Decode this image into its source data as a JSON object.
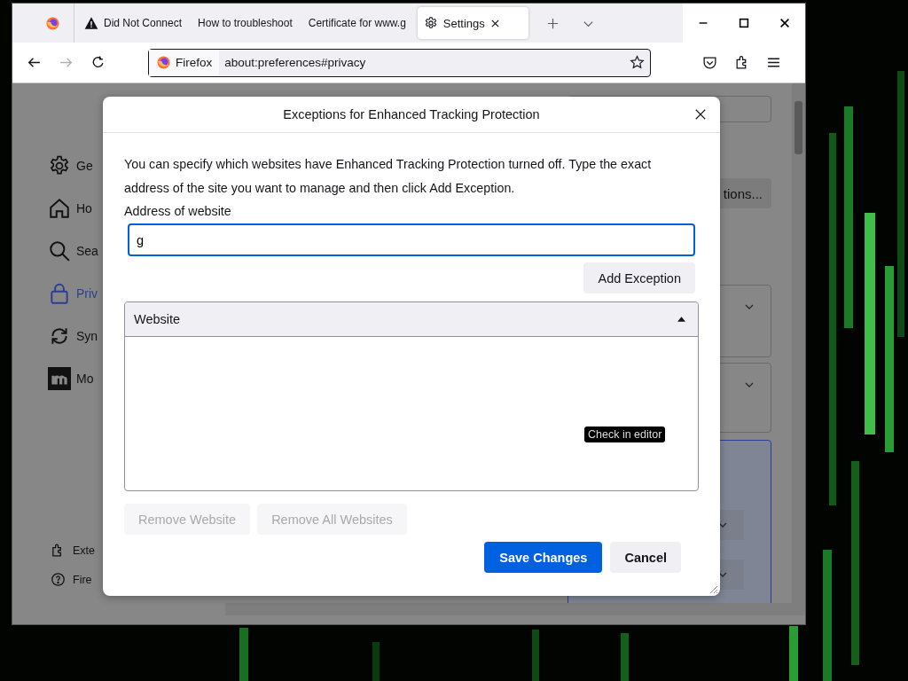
{
  "tabs": [
    {
      "kind": "firefox-view",
      "selected": false
    },
    {
      "kind": "page",
      "title": "Did Not Connect",
      "selected": false
    },
    {
      "kind": "page",
      "title": "How to troubleshoot",
      "selected": false
    },
    {
      "kind": "page",
      "title": "Certificate for www.g",
      "selected": false
    },
    {
      "kind": "page",
      "title": "Settings",
      "selected": true
    }
  ],
  "nav_buttons": [
    {
      "kind": "back",
      "disabled": false
    },
    {
      "kind": "forward",
      "disabled": true
    },
    {
      "kind": "reload",
      "disabled": false
    }
  ],
  "address_bar": {
    "identity": "Firefox",
    "url": "about:preferences#privacy"
  },
  "settings": {
    "categories": [
      {
        "label": "Ge",
        "selected": false
      },
      {
        "label": "Ho",
        "selected": false
      },
      {
        "label": "Sea",
        "selected": false
      },
      {
        "label": "Priv",
        "selected": true
      },
      {
        "label": "Syn",
        "selected": false
      },
      {
        "label": "Mo",
        "selected": false
      }
    ],
    "footer_links": [
      "Exte",
      "Fire"
    ],
    "button_1": "tions..."
  },
  "dialog": {
    "title": "Exceptions for Enhanced Tracking Protection",
    "description": "You can specify which websites have Enhanced Tracking Protection turned off. Type the exact address of the site you want to manage and then click Add Exception.",
    "address_label": "Address of website",
    "address_value": "g",
    "add_button": "Add Exception",
    "table": {
      "columns": [
        "Website"
      ]
    },
    "tooltip": "Check in editor",
    "remove_buttons": [
      {
        "label": "Remove Website",
        "disabled": true
      },
      {
        "label": "Remove All Websites",
        "disabled": true
      }
    ],
    "save_button": "Save Changes",
    "cancel_button": "Cancel"
  }
}
